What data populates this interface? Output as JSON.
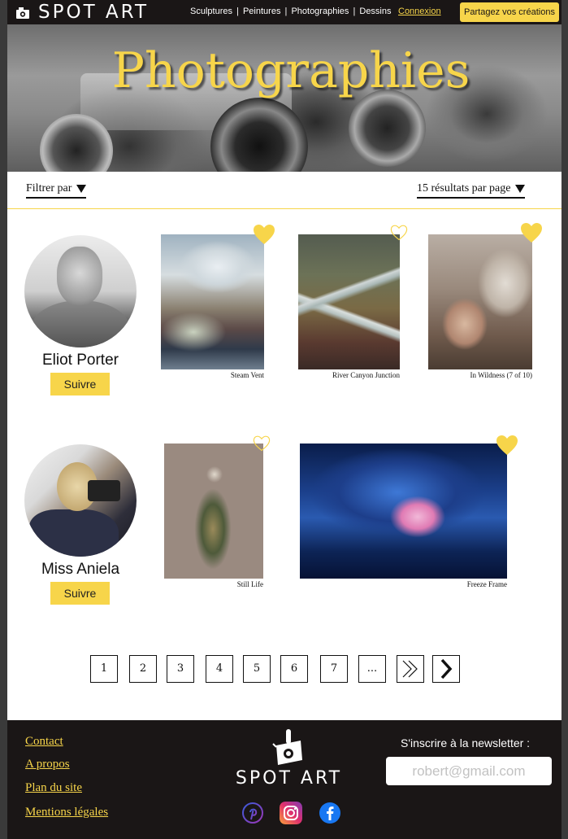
{
  "header": {
    "brand": "SPOT ART",
    "nav": [
      "Sculptures",
      "Peintures",
      "Photographies",
      "Dessins"
    ],
    "nav_separator": "|",
    "login": "Connexion",
    "share": "Partagez vos créations",
    "logo_icon": "camera-logo-icon"
  },
  "hero": {
    "title": "Photographies"
  },
  "filters": {
    "filter_label": "Filtrer par",
    "per_page_label": "15 résultats par page"
  },
  "artists": [
    {
      "name": "Eliot Porter",
      "follow": "Suivre",
      "works": [
        {
          "title": "Steam Vent",
          "liked": true
        },
        {
          "title": "River Canyon Junction",
          "liked": false
        },
        {
          "title": "In Wildness (7 of 10)",
          "liked": true
        }
      ]
    },
    {
      "name": "Miss Aniela",
      "follow": "Suivre",
      "works": [
        {
          "title": "Still Life",
          "liked": false
        },
        {
          "title": "Freeze Frame",
          "liked": true
        }
      ]
    }
  ],
  "pagination": {
    "pages": [
      "1",
      "2",
      "3",
      "4",
      "5",
      "6",
      "7",
      "..."
    ],
    "last_icon": "double-chevron-right-icon",
    "next_icon": "chevron-right-icon"
  },
  "footer": {
    "links": [
      "Contact",
      "A propos",
      "Plan du site",
      "Mentions légales"
    ],
    "brand": "SPOT ART",
    "newsletter_label": "S'inscrire à la newsletter :",
    "newsletter_placeholder": "robert@gmail.com",
    "social": [
      "pinterest-icon",
      "instagram-icon",
      "facebook-icon"
    ]
  },
  "colors": {
    "accent": "#f7d54a",
    "dark": "#1a1616"
  }
}
